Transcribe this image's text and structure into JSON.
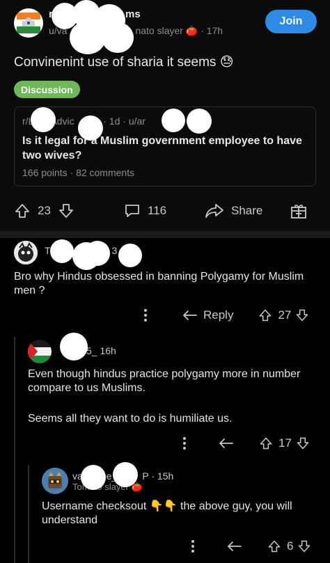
{
  "post": {
    "subreddit": "r/",
    "subreddit_suffix": "ms",
    "author_prefix": "u/va",
    "flair": "nato slayer",
    "age": "17h",
    "join_label": "Join",
    "title": "Convinenint use of sharia it seems",
    "tag": "Discussion",
    "crosspost": {
      "meta_left": "r/L",
      "meta_mid": "Advic",
      "meta_right": "a · 1d · u/ar",
      "title": "Is it legal for a Muslim government employee to have two wives?",
      "points": "166 points",
      "comments": "82 comments"
    },
    "upvotes": "23",
    "comment_count": "116",
    "share_label": "Share"
  },
  "comments": [
    {
      "author": "T",
      "author_suffix": "3",
      "text": "Bro why Hindus obsessed in banning Polygamy for Muslim men ?",
      "reply_label": "Reply",
      "score": "27"
    },
    {
      "author_suffix": "5_",
      "age": "16h",
      "text1": "Even though hindus practice polygamy more in number compare to us Muslims.",
      "text2": "Seems all they want to do is humiliate us.",
      "score": "17"
    },
    {
      "author": "va",
      "author_mid": "e_",
      "author_suffix": "P",
      "age": "15h",
      "flair": "Tomato slayer",
      "text": "Username checksout 👇👇 the above guy, you will understand",
      "score": "6"
    }
  ],
  "colors": {
    "accent": "#2d8ae6",
    "flair": "#6fb85a",
    "background": "#000000",
    "card": "#0b0b0b"
  }
}
